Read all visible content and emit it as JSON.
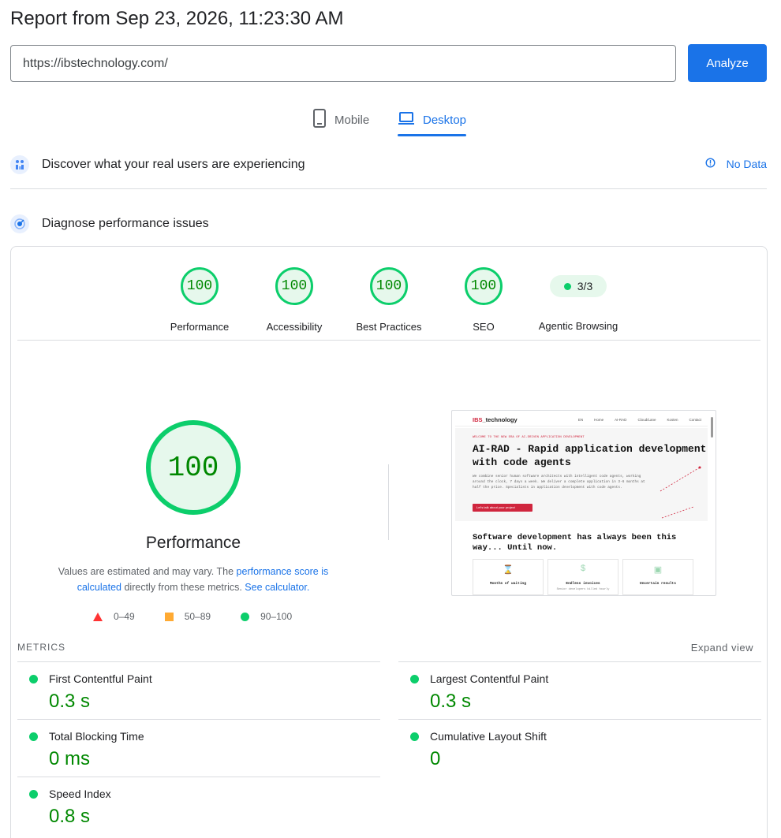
{
  "report": {
    "title": "Report from Sep 23, 2026, 11:23:30 AM"
  },
  "search": {
    "url": "https://ibstechnology.com/",
    "analyze_label": "Analyze"
  },
  "tabs": {
    "mobile": "Mobile",
    "desktop": "Desktop",
    "active": "Desktop"
  },
  "discover": {
    "title": "Discover what your real users are experiencing",
    "status": "No Data"
  },
  "diagnose": {
    "title": "Diagnose performance issues"
  },
  "categories": [
    {
      "label": "Performance",
      "score": "100"
    },
    {
      "label": "Accessibility",
      "score": "100"
    },
    {
      "label": "Best Practices",
      "score": "100"
    },
    {
      "label": "SEO",
      "score": "100"
    },
    {
      "label": "Agentic Browsing",
      "score": "3/3"
    }
  ],
  "performance": {
    "score": "100",
    "label": "Performance",
    "desc_1": "Values are estimated and may vary. The ",
    "link_1": "performance score is calculated",
    "desc_2": " directly from these metrics. ",
    "link_2": "See calculator."
  },
  "legend": {
    "fail": "0–49",
    "average": "50–89",
    "pass": "90–100"
  },
  "screenshot": {
    "logo_a": "IBS",
    "logo_b": "_technology",
    "nav": [
      "EN",
      "Home",
      "AI-RAD",
      "Cloud/Lane",
      "Kosten",
      "Contact"
    ],
    "kicker": "WELCOME TO THE NEW ERA OF AI-DRIVEN APPLICATION DEVELOPMENT",
    "headline": "AI-RAD - Rapid application development with code agents",
    "body": "We combine senior human software architects with intelligent code agents, working around the clock, 7 days a week. We deliver a complete application in 3-6 months at half the price. Specialists in application development with code agents.",
    "cta": "Let's talk about your project",
    "heading2": "Software development has always been this way... Until now.",
    "cards": [
      {
        "title": "Months of waiting",
        "sub": ""
      },
      {
        "title": "Endless invoices",
        "sub": "Senior developers billed hourly"
      },
      {
        "title": "Uncertain results",
        "sub": ""
      }
    ]
  },
  "metrics": {
    "heading": "METRICS",
    "expand": "Expand view",
    "fcp": {
      "label": "First Contentful Paint",
      "value": "0.3 s"
    },
    "lcp": {
      "label": "Largest Contentful Paint",
      "value": "0.3 s"
    },
    "tbt": {
      "label": "Total Blocking Time",
      "value": "0 ms"
    },
    "cls": {
      "label": "Cumulative Layout Shift",
      "value": "0"
    },
    "si": {
      "label": "Speed Index",
      "value": "0.8 s"
    }
  },
  "colors": {
    "accent": "#1a73e8",
    "pass": "#0cce6b",
    "pass_text": "#008800",
    "average": "#ffaa33",
    "fail": "#ff3333"
  }
}
